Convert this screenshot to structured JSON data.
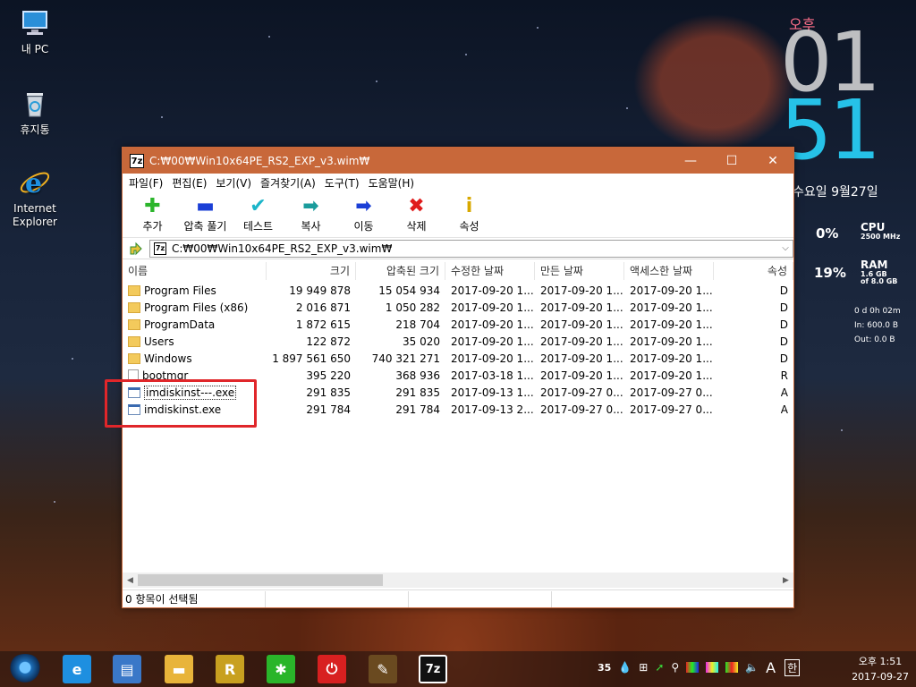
{
  "desktop": {
    "icons": [
      {
        "label": "내 PC",
        "icon": "computer-icon"
      },
      {
        "label": "휴지통",
        "icon": "recycle-bin-icon"
      },
      {
        "label": "Internet Explorer",
        "icon": "ie-icon"
      }
    ]
  },
  "clock_widget": {
    "ampm": "오후",
    "hour": "01",
    "minute": "51",
    "date": "수요일 9월27일"
  },
  "meters": {
    "cpu": {
      "percent": "0%",
      "label": "CPU",
      "sub": "2500 MHz"
    },
    "ram": {
      "percent": "19%",
      "label": "RAM",
      "sub1": "1.6 GB",
      "sub2": "of  8.0 GB"
    },
    "net": {
      "uptime": "0 d 0h 02m",
      "in": "In: 600.0 B",
      "out": "Out: 0.0 B"
    }
  },
  "window": {
    "title": "C:₩00₩Win10x64PE_RS2_EXP_v3.wim₩",
    "controls": {
      "minimize": "—",
      "maximize": "☐",
      "close": "✕"
    },
    "menu": [
      "파일(F)",
      "편집(E)",
      "보기(V)",
      "즐겨찾기(A)",
      "도구(T)",
      "도움말(H)"
    ],
    "toolbar": [
      {
        "label": "추가",
        "icon": "plus-icon",
        "glyph": "✚",
        "color": "#2bb52b"
      },
      {
        "label": "압축 풀기",
        "icon": "minus-icon",
        "glyph": "▬",
        "color": "#1b3fd6"
      },
      {
        "label": "테스트",
        "icon": "check-icon",
        "glyph": "✔",
        "color": "#1bb5c9"
      },
      {
        "label": "복사",
        "icon": "copy-arrow-icon",
        "glyph": "➡",
        "color": "#1a9c9c"
      },
      {
        "label": "이동",
        "icon": "move-arrow-icon",
        "glyph": "➡",
        "color": "#1b3fd6"
      },
      {
        "label": "삭제",
        "icon": "delete-x-icon",
        "glyph": "✖",
        "color": "#e01b1b"
      },
      {
        "label": "속성",
        "icon": "info-icon",
        "glyph": "i",
        "color": "#d8a800"
      }
    ],
    "address": {
      "icon_text": "7z",
      "path": "C:₩00₩Win10x64PE_RS2_EXP_v3.wim₩",
      "dropdown": "⌵"
    },
    "columns": [
      "이름",
      "크기",
      "압축된 크기",
      "수정한 날짜",
      "만든 날짜",
      "액세스한 날짜",
      "속성"
    ],
    "rows": [
      {
        "name": "Program Files",
        "type": "folder",
        "size": "19 949 878",
        "packed": "15 054 934",
        "modified": "2017-09-20 1...",
        "created": "2017-09-20 1...",
        "accessed": "2017-09-20 1...",
        "attr": "D"
      },
      {
        "name": "Program Files (x86)",
        "type": "folder",
        "size": "2 016 871",
        "packed": "1 050 282",
        "modified": "2017-09-20 1...",
        "created": "2017-09-20 1...",
        "accessed": "2017-09-20 1...",
        "attr": "D"
      },
      {
        "name": "ProgramData",
        "type": "folder",
        "size": "1 872 615",
        "packed": "218 704",
        "modified": "2017-09-20 1...",
        "created": "2017-09-20 1...",
        "accessed": "2017-09-20 1...",
        "attr": "D"
      },
      {
        "name": "Users",
        "type": "folder",
        "size": "122 872",
        "packed": "35 020",
        "modified": "2017-09-20 1...",
        "created": "2017-09-20 1...",
        "accessed": "2017-09-20 1...",
        "attr": "D"
      },
      {
        "name": "Windows",
        "type": "folder",
        "size": "1 897 561 650",
        "packed": "740 321 271",
        "modified": "2017-09-20 1...",
        "created": "2017-09-20 1...",
        "accessed": "2017-09-20 1...",
        "attr": "D"
      },
      {
        "name": "bootmgr",
        "type": "file",
        "size": "395 220",
        "packed": "368 936",
        "modified": "2017-03-18 1...",
        "created": "2017-09-20 1...",
        "accessed": "2017-09-20 1...",
        "attr": "R"
      },
      {
        "name": "imdiskinst---.exe",
        "type": "exe",
        "size": "291 835",
        "packed": "291 835",
        "modified": "2017-09-13 1...",
        "created": "2017-09-27 0...",
        "accessed": "2017-09-27 0...",
        "attr": "A"
      },
      {
        "name": "imdiskinst.exe",
        "type": "exe",
        "size": "291 784",
        "packed": "291 784",
        "modified": "2017-09-13 2...",
        "created": "2017-09-27 0...",
        "accessed": "2017-09-27 0...",
        "attr": "A"
      }
    ],
    "status": "0 항목이 선택됨",
    "hscroll": {
      "left": "◀",
      "right": "▶"
    }
  },
  "taskbar": {
    "apps": [
      {
        "name": "internet-explorer",
        "glyph": "e",
        "color": "#1e8fe0"
      },
      {
        "name": "notepad",
        "glyph": "▤",
        "color": "#3a78c8"
      },
      {
        "name": "file-explorer",
        "glyph": "▬",
        "color": "#e8b43a"
      },
      {
        "name": "r-app",
        "glyph": "R",
        "color": "#c8a020"
      },
      {
        "name": "green-app",
        "glyph": "✱",
        "color": "#2ab52a"
      },
      {
        "name": "power-app",
        "glyph": "⏻",
        "color": "#d82020"
      },
      {
        "name": "paint-app",
        "glyph": "✎",
        "color": "#6a4a20"
      },
      {
        "name": "7zip",
        "glyph": "7z",
        "color": "#111111"
      }
    ],
    "tray": {
      "temp": "35",
      "lang": "A",
      "ime": "한"
    },
    "clock": {
      "time": "오후 1:51",
      "date": "2017-09-27"
    }
  }
}
